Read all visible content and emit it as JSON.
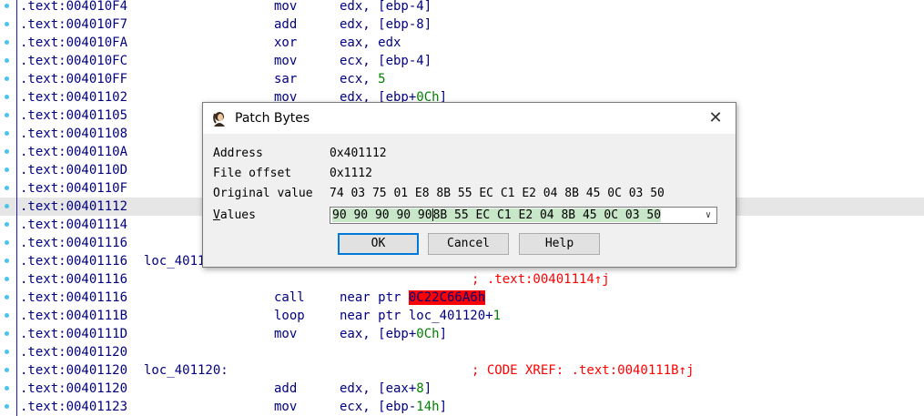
{
  "listing": {
    "rows": [
      {
        "addr": ".text:004010F4",
        "label": "",
        "mnem": "mov",
        "ops": "edx, [ebp-4]",
        "comment": ""
      },
      {
        "addr": ".text:004010F7",
        "label": "",
        "mnem": "add",
        "ops": "edx, [ebp-8]",
        "comment": ""
      },
      {
        "addr": ".text:004010FA",
        "label": "",
        "mnem": "xor",
        "ops": "eax, edx",
        "comment": ""
      },
      {
        "addr": ".text:004010FC",
        "label": "",
        "mnem": "mov",
        "ops": "ecx, [ebp-4]",
        "comment": ""
      },
      {
        "addr": ".text:004010FF",
        "label": "",
        "mnem": "sar",
        "ops": "ecx, ",
        "num": "5",
        "comment": ""
      },
      {
        "addr": ".text:00401102",
        "label": "",
        "mnem": "mov",
        "ops": "edx, [ebp+",
        "num": "0Ch",
        "ops_tail": "]",
        "comment": ""
      },
      {
        "addr": ".text:00401105",
        "label": "",
        "mnem": "",
        "ops": "",
        "comment": ""
      },
      {
        "addr": ".text:00401108",
        "label": "",
        "mnem": "",
        "ops": "",
        "comment": ""
      },
      {
        "addr": ".text:0040110A",
        "label": "",
        "mnem": "",
        "ops": "",
        "comment": ""
      },
      {
        "addr": ".text:0040110D",
        "label": "",
        "mnem": "",
        "ops": "",
        "comment": ""
      },
      {
        "addr": ".text:0040110F",
        "label": "",
        "mnem": "",
        "ops": "",
        "comment": ""
      },
      {
        "addr": ".text:00401112",
        "label": "",
        "mnem": "",
        "ops": "",
        "comment": ""
      },
      {
        "addr": ".text:00401114",
        "label": "",
        "mnem": "",
        "ops": "",
        "comment": ""
      },
      {
        "addr": ".text:00401116",
        "label": "",
        "mnem": "",
        "ops": "",
        "comment": ""
      },
      {
        "addr": ".text:00401116",
        "label": "loc_401116:",
        "mnem": "",
        "ops": "",
        "comment": ""
      },
      {
        "addr": ".text:00401116",
        "label": "",
        "mnem": "",
        "ops": "",
        "comment": "; .text:00401114↑j"
      },
      {
        "addr": ".text:00401116",
        "label": "",
        "mnem": "call",
        "ops": "near ptr ",
        "red": "0C22C66A6h",
        "comment": ""
      },
      {
        "addr": ".text:0040111B",
        "label": "",
        "mnem": "loop",
        "ops": "near ptr loc_401120+",
        "num": "1",
        "comment": ""
      },
      {
        "addr": ".text:0040111D",
        "label": "",
        "mnem": "mov",
        "ops": "eax, [ebp+",
        "num": "0Ch",
        "ops_tail": "]",
        "comment": ""
      },
      {
        "addr": ".text:00401120",
        "label": "",
        "mnem": "",
        "ops": "",
        "comment": ""
      },
      {
        "addr": ".text:00401120",
        "label": "loc_401120:",
        "mnem": "",
        "ops": "",
        "comment": "; CODE XREF: .text:0040111B↑j"
      },
      {
        "addr": ".text:00401120",
        "label": "",
        "mnem": "add",
        "ops": "edx, [eax+",
        "num": "8",
        "ops_tail": "]",
        "comment": ""
      },
      {
        "addr": ".text:00401123",
        "label": "",
        "mnem": "mov",
        "ops": "ecx, [ebp-",
        "num": "14h",
        "ops_tail": "]",
        "comment": ""
      }
    ],
    "highlight_row": 11
  },
  "dialog": {
    "title": "Patch Bytes",
    "close_glyph": "✕",
    "address_label": "Address",
    "address_value": "0x401112",
    "file_offset_label": "File offset",
    "file_offset_value": "0x1112",
    "original_label": "Original value",
    "original_value": "74 03 75 01 E8 8B 55 EC C1 E2 04 8B 45 0C 03 50",
    "values_label_first": "V",
    "values_label_rest": "alues",
    "values_selected": "90 90 90 90 90",
    "values_rest": "8B 55 EC C1 E2 04 8B 45 0C 03 50",
    "dropdown_glyph": "∨",
    "ok_label": "OK",
    "cancel_label": "Cancel",
    "help_label": "Help"
  },
  "colors": {
    "code_text": "#000080",
    "comment": "#ff0000",
    "number": "#008000",
    "highlight": "#e6e6e6"
  }
}
